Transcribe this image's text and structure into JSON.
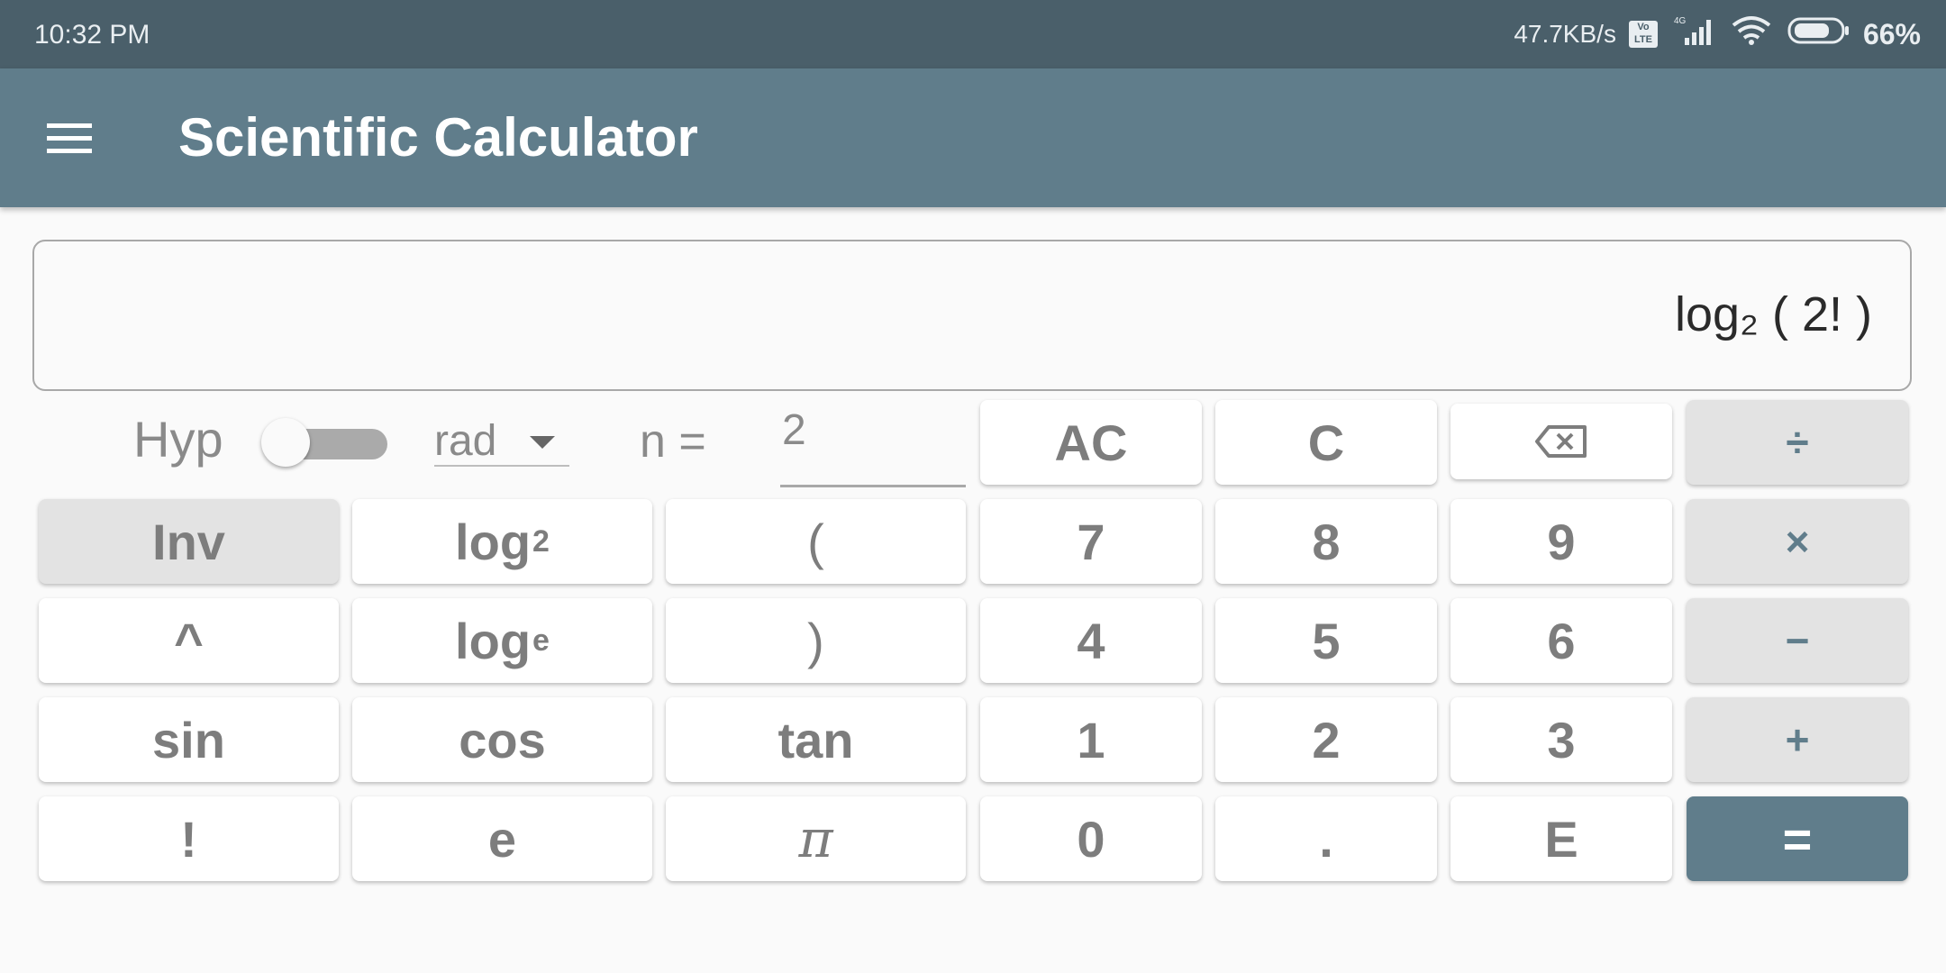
{
  "status_bar": {
    "time": "10:32 PM",
    "network_speed": "47.7KB/s",
    "volte": "Vo LTE",
    "network_type": "4G",
    "battery": "66%"
  },
  "app_bar": {
    "title": "Scientific Calculator",
    "menu_icon": "hamburger-menu-icon"
  },
  "display": {
    "expression": "log₂ ( 2! )"
  },
  "controls": {
    "hyp_label": "Hyp",
    "hyp_enabled": false,
    "angle_unit": "rad",
    "n_label": "n =",
    "n_value": "2"
  },
  "keys": {
    "ac": "AC",
    "c": "C",
    "backspace_icon": "backspace-icon",
    "divide": "÷",
    "inv": "Inv",
    "log2": "log",
    "log2_sub": "2",
    "open_paren": "(",
    "seven": "7",
    "eight": "8",
    "nine": "9",
    "multiply": "×",
    "power": "^",
    "loge": "log",
    "loge_sub": "e",
    "close_paren": ")",
    "four": "4",
    "five": "5",
    "six": "6",
    "minus": "−",
    "sin": "sin",
    "cos": "cos",
    "tan": "tan",
    "one": "1",
    "two": "2",
    "three": "3",
    "plus": "+",
    "factorial": "!",
    "e": "e",
    "pi": "π",
    "zero": "0",
    "decimal": ".",
    "exp": "E",
    "equals": "="
  },
  "colors": {
    "status_bar": "#4a5f6a",
    "app_bar": "#607d8b",
    "background": "#fafafa",
    "key": "#ffffff",
    "key_grey": "#e3e3e3",
    "key_text": "#7d7d7d",
    "operator_text": "#607d8b",
    "equals_key": "#607d8b"
  }
}
